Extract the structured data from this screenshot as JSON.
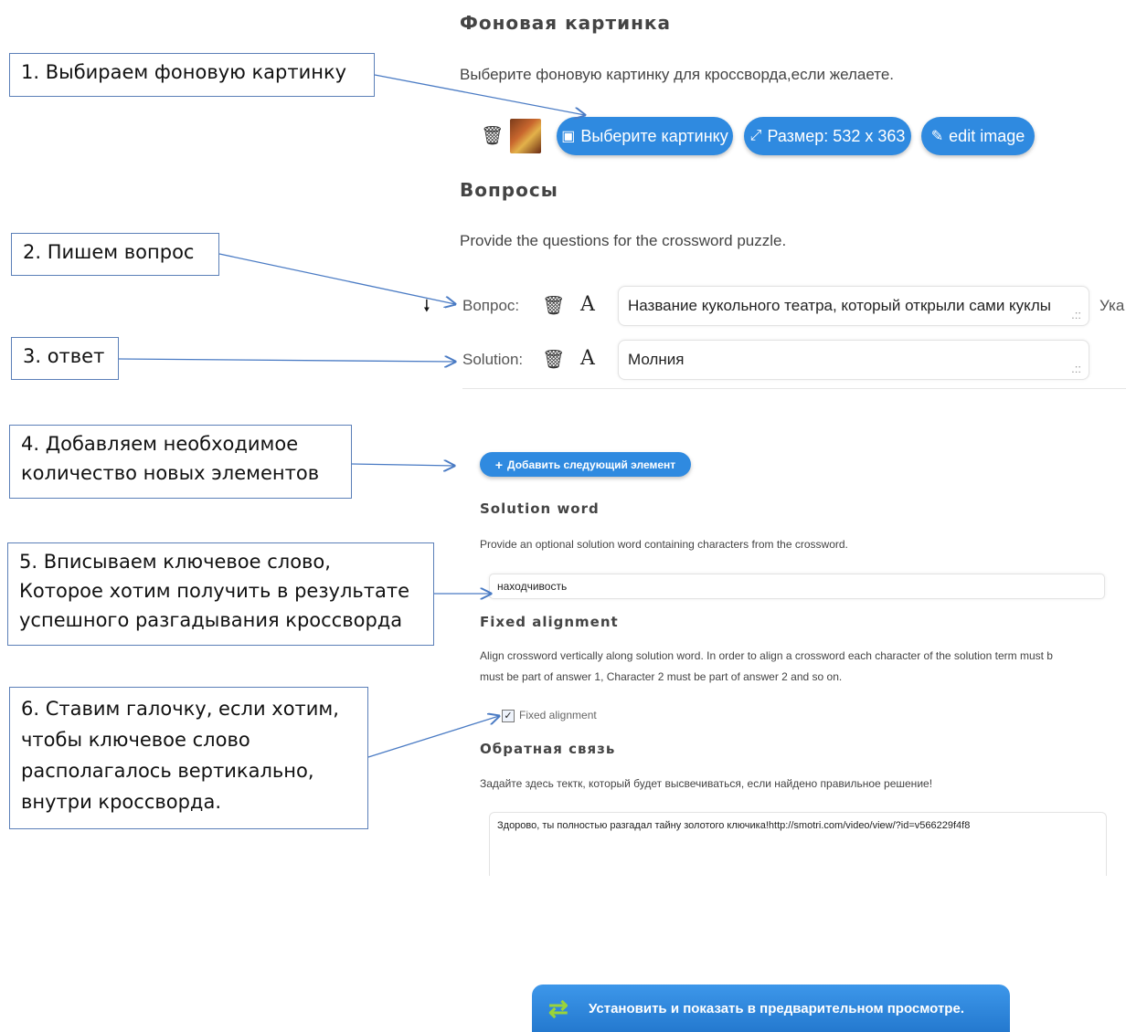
{
  "background": {
    "title": "Фоновая картинка",
    "description": "Выберите фоновую картинку для кроссворда,если желаете.",
    "choose_label": "Выберите картинку",
    "size_label": "Размер: 532 x 363",
    "edit_label": "edit image"
  },
  "questions": {
    "title": "Вопросы",
    "description": "Provide the questions for the crossword puzzle.",
    "question_label": "Вопрос:",
    "question_value": "Название кукольного театра, который открыли сами куклы",
    "question_after": "Ука",
    "solution_label": "Solution:",
    "solution_value": "Молния",
    "add_label": "Добавить следующий элемент"
  },
  "solution_word": {
    "title": "Solution word",
    "description": "Provide an optional solution word containing characters from the crossword.",
    "value": "находчивость"
  },
  "fixed_alignment": {
    "title": "Fixed alignment",
    "description_1": "Align crossword vertically along solution word. In order to align a crossword each character of the solution term must b",
    "description_2": "must be part of answer 1, Character 2 must be part of answer 2 and so on.",
    "checkbox_label": "Fixed alignment",
    "checked": true
  },
  "feedback": {
    "title": "Обратная связь",
    "description": "Задайте здесь тектк, который будет высвечиваться, если найдено правильное решение!",
    "value": "Здорово, ты полностью разгадал тайну золотого ключика!http://smotri.com/video/view/?id=v566229f4f8"
  },
  "preview_button": "Установить и показать в предварительном просмотре.",
  "callouts": {
    "c1": "1. Выбираем фоновую картинку",
    "c2": "2. Пишем вопрос",
    "c3": "3. ответ",
    "c4_l1": "4. Добавляем необходимое",
    "c4_l2": "количество новых элементов",
    "c5_l1": "5. Вписываем ключевое слово,",
    "c5_l2": "Которое хотим получить в результате",
    "c5_l3": "успешного разгадывания кроссворда",
    "c6_l1": "6. Ставим галочку, если хотим,",
    "c6_l2": "чтобы ключевое слово",
    "c6_l3": "располагалось вертикально,",
    "c6_l4": "внутри кроссворда."
  },
  "colors": {
    "accent": "#2f8ae0",
    "callout_border": "#5b7fb8",
    "arrow": "#4a7bc4"
  }
}
